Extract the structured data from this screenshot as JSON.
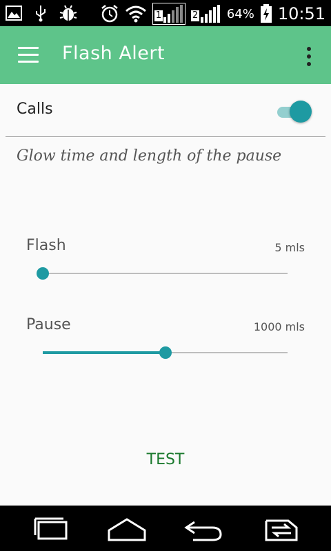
{
  "status_bar": {
    "signal_sim1": "1",
    "signal_sim2": "2",
    "battery": "64%",
    "time": "10:51",
    "icons": [
      "gallery-icon",
      "usb-icon",
      "debug-bug-icon",
      "alarm-icon",
      "wifi-icon",
      "signal-icon",
      "signal-icon",
      "battery-charging-icon"
    ]
  },
  "app_bar": {
    "title": "Flash Alert",
    "background": "#5ec48a"
  },
  "calls": {
    "label": "Calls",
    "enabled": true
  },
  "subtitle": "Glow time and length of the pause",
  "flash": {
    "label": "Flash",
    "value": "5 mls",
    "fraction": 0.0
  },
  "pause": {
    "label": "Pause",
    "value": "1000 mls",
    "fraction": 0.5
  },
  "test_label": "TEST",
  "accent": "#1e9aa2",
  "nav": [
    "recent-apps-icon",
    "home-icon",
    "back-icon",
    "dual-window-icon"
  ]
}
